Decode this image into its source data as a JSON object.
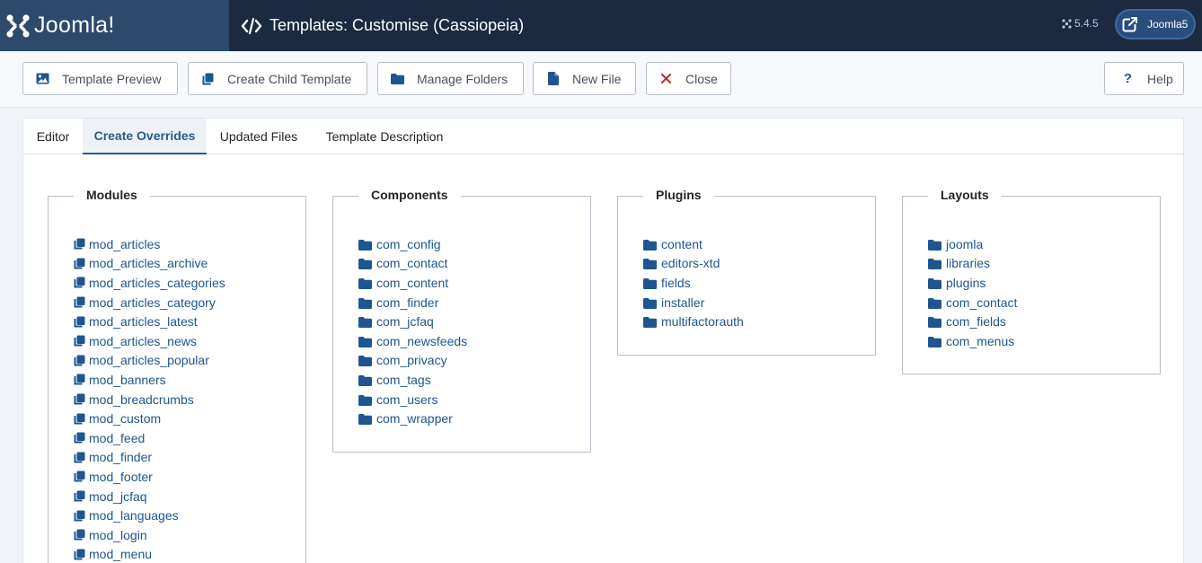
{
  "header": {
    "logo_text": "Joomla!",
    "title": "Templates: Customise (Cassiopeia)",
    "version": "5.4.5",
    "site_label": "Joomla5"
  },
  "toolbar": {
    "buttons": [
      {
        "label": "Template Preview",
        "icon": "image-icon"
      },
      {
        "label": "Create Child Template",
        "icon": "copy-icon"
      },
      {
        "label": "Manage Folders",
        "icon": "folder-icon"
      },
      {
        "label": "New File",
        "icon": "file-icon"
      },
      {
        "label": "Close",
        "icon": "close-icon"
      }
    ],
    "help": {
      "label": "Help",
      "icon": "question-icon"
    }
  },
  "tabs": [
    "Editor",
    "Create Overrides",
    "Updated Files",
    "Template Description"
  ],
  "active_tab": "Create Overrides",
  "colors": {
    "header": "#1b2a40",
    "logo_bg": "#2c4a6b",
    "link": "#1f5590",
    "close_icon": "#c52827",
    "active_tab": "#2a5a8c"
  },
  "sections": {
    "modules": {
      "title": "Modules",
      "icon": "copy-icon",
      "items": [
        "mod_articles",
        "mod_articles_archive",
        "mod_articles_categories",
        "mod_articles_category",
        "mod_articles_latest",
        "mod_articles_news",
        "mod_articles_popular",
        "mod_banners",
        "mod_breadcrumbs",
        "mod_custom",
        "mod_feed",
        "mod_finder",
        "mod_footer",
        "mod_jcfaq",
        "mod_languages",
        "mod_login",
        "mod_menu"
      ]
    },
    "components": {
      "title": "Components",
      "icon": "folder-icon",
      "items": [
        "com_config",
        "com_contact",
        "com_content",
        "com_finder",
        "com_jcfaq",
        "com_newsfeeds",
        "com_privacy",
        "com_tags",
        "com_users",
        "com_wrapper"
      ]
    },
    "plugins": {
      "title": "Plugins",
      "icon": "folder-icon",
      "items": [
        "content",
        "editors-xtd",
        "fields",
        "installer",
        "multifactorauth"
      ]
    },
    "layouts": {
      "title": "Layouts",
      "icon": "folder-icon",
      "items": [
        "joomla",
        "libraries",
        "plugins",
        "com_contact",
        "com_fields",
        "com_menus"
      ]
    }
  }
}
